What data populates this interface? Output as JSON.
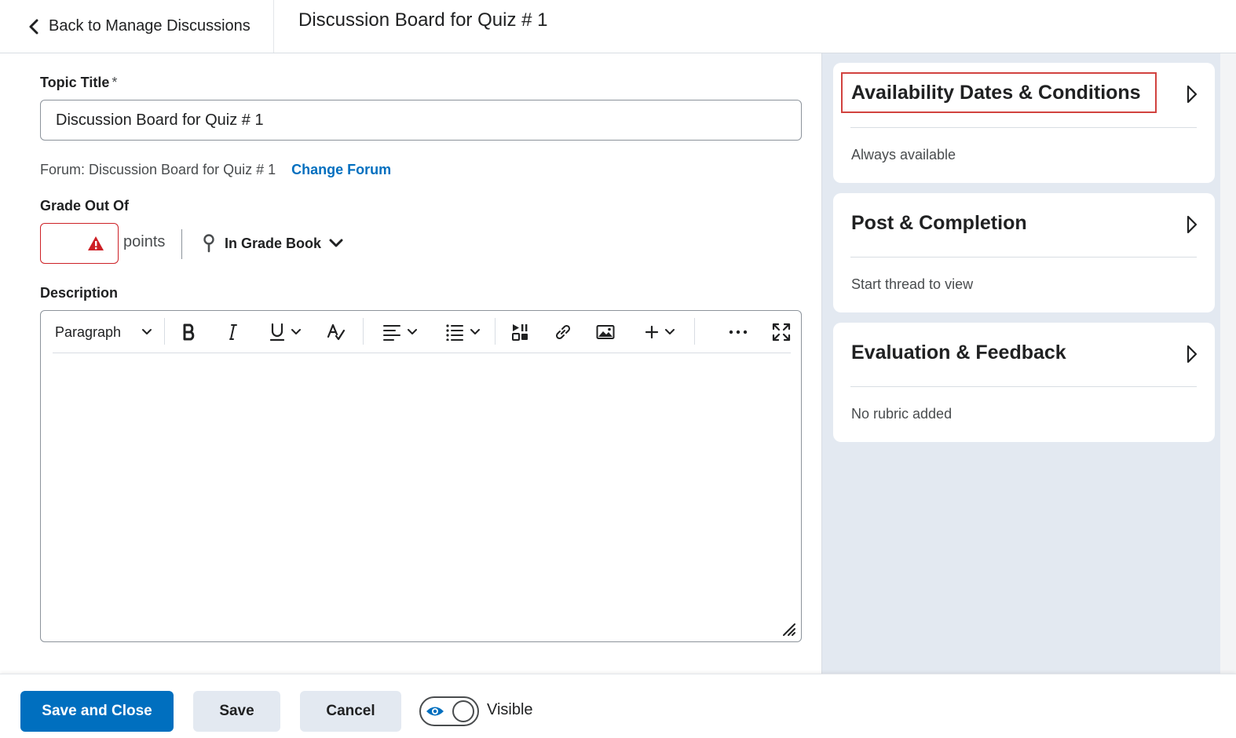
{
  "header": {
    "back_label": "Back to Manage Discussions",
    "title": "Discussion Board for Quiz # 1"
  },
  "form": {
    "topic_title_label": "Topic Title",
    "required_marker": "*",
    "topic_title_value": "Discussion Board for Quiz # 1",
    "forum_text": "Forum: Discussion Board for Quiz # 1",
    "change_forum_label": "Change Forum",
    "grade_label": "Grade Out Of",
    "grade_value": "",
    "points_label": "points",
    "grade_book_label": "In Grade Book",
    "description_label": "Description"
  },
  "editor": {
    "format_select": "Paragraph",
    "content": ""
  },
  "footer": {
    "save_close_label": "Save and Close",
    "save_label": "Save",
    "cancel_label": "Cancel",
    "visible_label": "Visible"
  },
  "sidebar": {
    "cards": [
      {
        "title": "Availability Dates & Conditions",
        "summary": "Always available"
      },
      {
        "title": "Post & Completion",
        "summary": "Start thread to view"
      },
      {
        "title": "Evaluation & Feedback",
        "summary": "No rubric added"
      }
    ]
  },
  "colors": {
    "primary": "#006fbf",
    "error": "#cd2026",
    "highlight": "#d1423f",
    "sidebar_bg": "#e3e9f1",
    "secondary_button": "#e3e9f1"
  },
  "icons": [
    "chevron-left-icon",
    "warning-icon",
    "pin-icon",
    "chevron-down-icon",
    "bold-icon",
    "italic-icon",
    "underline-icon",
    "strikethrough-format-icon",
    "align-icon",
    "list-icon",
    "media-icon",
    "link-icon",
    "image-icon",
    "plus-icon",
    "more-icon",
    "fullscreen-icon",
    "resize-icon",
    "caret-right-icon",
    "eye-icon"
  ]
}
